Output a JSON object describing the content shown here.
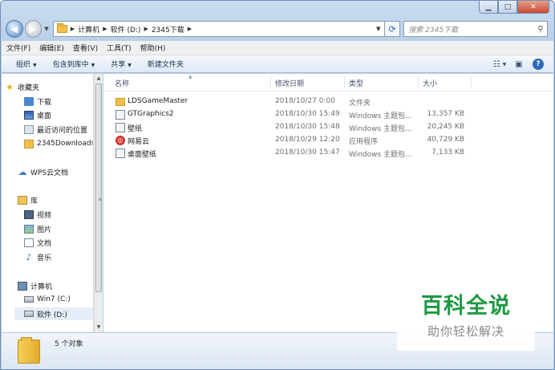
{
  "window": {
    "address": {
      "crumbs": [
        "计算机",
        "软件 (D:)",
        "2345下载"
      ]
    },
    "search_placeholder": "搜索 2345下载"
  },
  "menubar": [
    "文件(F)",
    "编辑(E)",
    "查看(V)",
    "工具(T)",
    "帮助(H)"
  ],
  "toolbar": {
    "organize": "组织",
    "include_library": "包含到库中",
    "share": "共享",
    "new_folder": "新建文件夹"
  },
  "navpane": {
    "favorites_header": "收藏夹",
    "favorites": [
      "下载",
      "桌面",
      "最近访问的位置",
      "2345Downloads"
    ],
    "wps": "WPS云文档",
    "libraries_header": "库",
    "libraries": [
      "视频",
      "图片",
      "文档",
      "音乐"
    ],
    "computer_header": "计算机",
    "drives": [
      "Win7 (C:)",
      "软件 (D:)"
    ]
  },
  "columns": {
    "name": "名称",
    "date": "修改日期",
    "type": "类型",
    "size": "大小"
  },
  "files": [
    {
      "name": "LDSGameMaster",
      "date": "2018/10/27 0:00",
      "type": "文件夹",
      "size": "",
      "icon": "folder-icon"
    },
    {
      "name": "GTGraphics2",
      "date": "2018/10/30 15:49",
      "type": "Windows 主题包...",
      "size": "13,357 KB",
      "icon": "theme-file-icon"
    },
    {
      "name": "壁纸",
      "date": "2018/10/30 15:48",
      "type": "Windows 主题包...",
      "size": "20,245 KB",
      "icon": "theme-file-icon"
    },
    {
      "name": "网易云",
      "date": "2018/10/29 12:20",
      "type": "应用程序",
      "size": "40,729 KB",
      "icon": "netease-app-icon"
    },
    {
      "name": "桌面壁纸",
      "date": "2018/10/30 15:47",
      "type": "Windows 主题包...",
      "size": "7,133 KB",
      "icon": "theme-file-icon"
    }
  ],
  "status": {
    "count": "5 个对象"
  },
  "watermark": {
    "title": "百科全说",
    "subtitle": "助你轻松解决",
    "color": "#1d9a42"
  }
}
